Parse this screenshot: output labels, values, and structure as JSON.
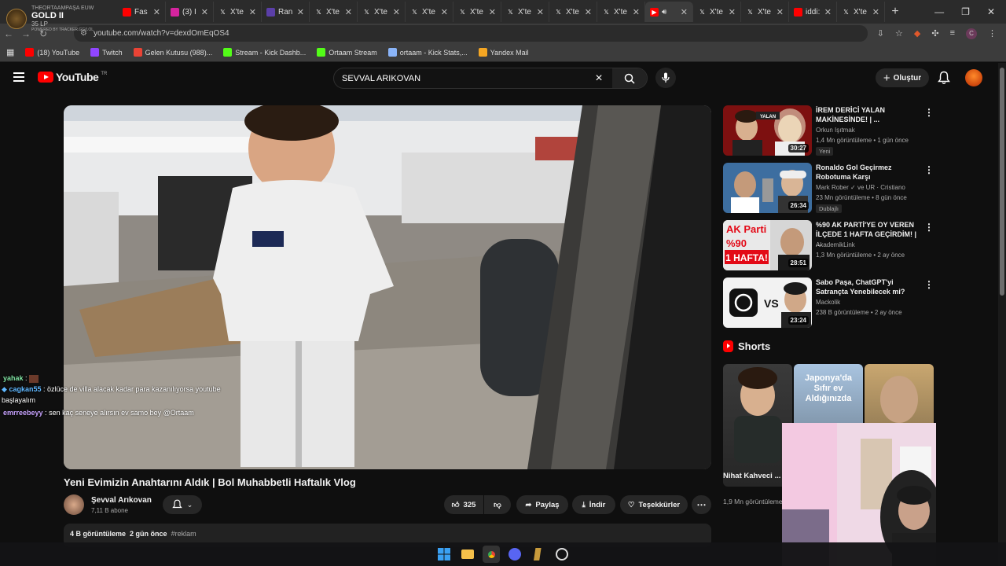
{
  "overlay": {
    "lines": [
      "THEORTAAMPAŞA EUW",
      "GOLD II",
      "35 LP",
      "POWERED BY TRACKER.GG/LOL"
    ]
  },
  "tabs": [
    {
      "label": "THEORTAAMPAŞA EUW",
      "icon": "league-icon",
      "color": "#c89b3c"
    },
    {
      "label": "Fas",
      "icon": "youtube-icon",
      "color": "#ff0000"
    },
    {
      "label": "(3) I",
      "icon": "instagram-icon",
      "color": "#d6249f"
    },
    {
      "label": "X'te",
      "icon": "x-icon",
      "color": "#000000"
    },
    {
      "label": "Ran",
      "icon": "ranking-icon",
      "color": "#5b3fa8"
    },
    {
      "label": "X'te",
      "icon": "x-icon",
      "color": "#000000"
    },
    {
      "label": "X'te",
      "icon": "x-icon",
      "color": "#000000"
    },
    {
      "label": "X'te",
      "icon": "x-icon",
      "color": "#000000"
    },
    {
      "label": "X'te",
      "icon": "x-icon",
      "color": "#000000"
    },
    {
      "label": "X'te",
      "icon": "x-icon",
      "color": "#000000"
    },
    {
      "label": "X'te",
      "icon": "x-icon",
      "color": "#000000"
    },
    {
      "label": "X'te",
      "icon": "x-icon",
      "color": "#000000"
    },
    {
      "label": "",
      "icon": "youtube-audio-icon",
      "color": "#ff0000",
      "active": true
    },
    {
      "label": "X'te",
      "icon": "x-icon",
      "color": "#000000"
    },
    {
      "label": "X'te",
      "icon": "x-icon",
      "color": "#000000"
    },
    {
      "label": "iddi:",
      "icon": "youtube-icon",
      "color": "#ff0000"
    },
    {
      "label": "X'te",
      "icon": "x-icon",
      "color": "#000000"
    }
  ],
  "address": {
    "url": "youtube.com/watch?v=dexdOmEqOS4",
    "profile": "C"
  },
  "bookmarks": [
    {
      "label": "(18) YouTube",
      "icon": "youtube-icon",
      "color": "#ff0000"
    },
    {
      "label": "Twitch",
      "icon": "twitch-icon",
      "color": "#9146ff"
    },
    {
      "label": "Gelen Kutusu (988)...",
      "icon": "gmail-icon",
      "color": "#ea4335"
    },
    {
      "label": "Stream - Kick Dashb...",
      "icon": "kick-icon",
      "color": "#53fc18"
    },
    {
      "label": "Ortaam Stream",
      "icon": "kick-icon",
      "color": "#53fc18"
    },
    {
      "label": "ortaam - Kick Stats,...",
      "icon": "stats-icon",
      "color": "#8ab4f8"
    },
    {
      "label": "Yandex Mail",
      "icon": "mail-icon",
      "color": "#f5a623"
    }
  ],
  "youtube": {
    "region": "TR",
    "logo_text": "YouTube",
    "search_value": "SEVVAL ARIKOVAN",
    "create_label": "Oluştur"
  },
  "video": {
    "title": "Yeni Evimizin Anahtarını Aldık | Bol Muhabbetli Haftalık Vlog",
    "channel": "Şevval Arıkovan",
    "subscribers": "7,11 B abone",
    "likes": "325",
    "share": "Paylaş",
    "download": "İndir",
    "thanks": "Teşekkürler",
    "views": "4 B görüntüleme",
    "age": "2 gün önce",
    "tag": "#reklam"
  },
  "chat": [
    {
      "user": "yahak",
      "text": ""
    },
    {
      "user": "cagkan55",
      "text": "özlüce de villa alacak kadar para kazanılıyorsa youtube başlayalım"
    },
    {
      "user": "emrreebeyy",
      "text": "sen kaç seneye alırsın ev samo bey @Ortaam"
    }
  ],
  "recommendations": [
    {
      "title": "İREM DERİCİ YALAN MAKİNESİNDE! | ...",
      "channel": "Orkun Işıtmak",
      "meta": "1,4 Mn görüntüleme • 1 gün önce",
      "badge": "Yeni",
      "duration": "30:27"
    },
    {
      "title": "Ronaldo Gol Geçirmez Robotuma Karşı",
      "channel": "Mark Rober ✓ ve UR · Cristiano",
      "meta": "23 Mn görüntüleme • 8 gün önce",
      "badge": "Dublajlı",
      "duration": "26:34"
    },
    {
      "title": "%90 AK PARTİ'YE OY VEREN İLÇEDE 1 HAFTA GEÇİRDİM! | ...",
      "channel": "AkademikLink",
      "meta": "1,3 Mn görüntüleme • 2 ay önce",
      "badge": "",
      "duration": "28:51"
    },
    {
      "title": "Sabo Paşa, ChatGPT'yi Satrançta Yenebilecek mi?",
      "channel": "Mackolik",
      "meta": "238 B görüntüleme • 2 ay önce",
      "badge": "",
      "duration": "23:24"
    }
  ],
  "thumb_texts": {
    "r1": "YALAN",
    "r3a": "AK Parti",
    "r3b": "%90",
    "r3c": "1 HAFTA!",
    "r4": "VS"
  },
  "shorts": {
    "heading": "Shorts",
    "items": [
      {
        "title": "Nihat Kahveci ...",
        "views": "1,9 Mn görüntüleme",
        "caption": ""
      },
      {
        "title": "",
        "views": "",
        "caption": "Japonya'da Sıfır ev Aldığınızda"
      },
      {
        "title": "",
        "views": "",
        "caption": ""
      }
    ]
  }
}
